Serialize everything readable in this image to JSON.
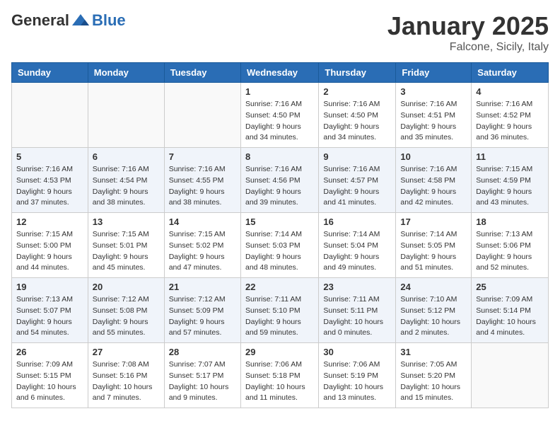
{
  "header": {
    "logo": {
      "general": "General",
      "blue": "Blue"
    },
    "title": "January 2025",
    "location": "Falcone, Sicily, Italy"
  },
  "weekdays": [
    "Sunday",
    "Monday",
    "Tuesday",
    "Wednesday",
    "Thursday",
    "Friday",
    "Saturday"
  ],
  "weeks": [
    [
      {
        "day": "",
        "sunrise": "",
        "sunset": "",
        "daylight": ""
      },
      {
        "day": "",
        "sunrise": "",
        "sunset": "",
        "daylight": ""
      },
      {
        "day": "",
        "sunrise": "",
        "sunset": "",
        "daylight": ""
      },
      {
        "day": "1",
        "sunrise": "Sunrise: 7:16 AM",
        "sunset": "Sunset: 4:50 PM",
        "daylight": "Daylight: 9 hours and 34 minutes."
      },
      {
        "day": "2",
        "sunrise": "Sunrise: 7:16 AM",
        "sunset": "Sunset: 4:50 PM",
        "daylight": "Daylight: 9 hours and 34 minutes."
      },
      {
        "day": "3",
        "sunrise": "Sunrise: 7:16 AM",
        "sunset": "Sunset: 4:51 PM",
        "daylight": "Daylight: 9 hours and 35 minutes."
      },
      {
        "day": "4",
        "sunrise": "Sunrise: 7:16 AM",
        "sunset": "Sunset: 4:52 PM",
        "daylight": "Daylight: 9 hours and 36 minutes."
      }
    ],
    [
      {
        "day": "5",
        "sunrise": "Sunrise: 7:16 AM",
        "sunset": "Sunset: 4:53 PM",
        "daylight": "Daylight: 9 hours and 37 minutes."
      },
      {
        "day": "6",
        "sunrise": "Sunrise: 7:16 AM",
        "sunset": "Sunset: 4:54 PM",
        "daylight": "Daylight: 9 hours and 38 minutes."
      },
      {
        "day": "7",
        "sunrise": "Sunrise: 7:16 AM",
        "sunset": "Sunset: 4:55 PM",
        "daylight": "Daylight: 9 hours and 38 minutes."
      },
      {
        "day": "8",
        "sunrise": "Sunrise: 7:16 AM",
        "sunset": "Sunset: 4:56 PM",
        "daylight": "Daylight: 9 hours and 39 minutes."
      },
      {
        "day": "9",
        "sunrise": "Sunrise: 7:16 AM",
        "sunset": "Sunset: 4:57 PM",
        "daylight": "Daylight: 9 hours and 41 minutes."
      },
      {
        "day": "10",
        "sunrise": "Sunrise: 7:16 AM",
        "sunset": "Sunset: 4:58 PM",
        "daylight": "Daylight: 9 hours and 42 minutes."
      },
      {
        "day": "11",
        "sunrise": "Sunrise: 7:15 AM",
        "sunset": "Sunset: 4:59 PM",
        "daylight": "Daylight: 9 hours and 43 minutes."
      }
    ],
    [
      {
        "day": "12",
        "sunrise": "Sunrise: 7:15 AM",
        "sunset": "Sunset: 5:00 PM",
        "daylight": "Daylight: 9 hours and 44 minutes."
      },
      {
        "day": "13",
        "sunrise": "Sunrise: 7:15 AM",
        "sunset": "Sunset: 5:01 PM",
        "daylight": "Daylight: 9 hours and 45 minutes."
      },
      {
        "day": "14",
        "sunrise": "Sunrise: 7:15 AM",
        "sunset": "Sunset: 5:02 PM",
        "daylight": "Daylight: 9 hours and 47 minutes."
      },
      {
        "day": "15",
        "sunrise": "Sunrise: 7:14 AM",
        "sunset": "Sunset: 5:03 PM",
        "daylight": "Daylight: 9 hours and 48 minutes."
      },
      {
        "day": "16",
        "sunrise": "Sunrise: 7:14 AM",
        "sunset": "Sunset: 5:04 PM",
        "daylight": "Daylight: 9 hours and 49 minutes."
      },
      {
        "day": "17",
        "sunrise": "Sunrise: 7:14 AM",
        "sunset": "Sunset: 5:05 PM",
        "daylight": "Daylight: 9 hours and 51 minutes."
      },
      {
        "day": "18",
        "sunrise": "Sunrise: 7:13 AM",
        "sunset": "Sunset: 5:06 PM",
        "daylight": "Daylight: 9 hours and 52 minutes."
      }
    ],
    [
      {
        "day": "19",
        "sunrise": "Sunrise: 7:13 AM",
        "sunset": "Sunset: 5:07 PM",
        "daylight": "Daylight: 9 hours and 54 minutes."
      },
      {
        "day": "20",
        "sunrise": "Sunrise: 7:12 AM",
        "sunset": "Sunset: 5:08 PM",
        "daylight": "Daylight: 9 hours and 55 minutes."
      },
      {
        "day": "21",
        "sunrise": "Sunrise: 7:12 AM",
        "sunset": "Sunset: 5:09 PM",
        "daylight": "Daylight: 9 hours and 57 minutes."
      },
      {
        "day": "22",
        "sunrise": "Sunrise: 7:11 AM",
        "sunset": "Sunset: 5:10 PM",
        "daylight": "Daylight: 9 hours and 59 minutes."
      },
      {
        "day": "23",
        "sunrise": "Sunrise: 7:11 AM",
        "sunset": "Sunset: 5:11 PM",
        "daylight": "Daylight: 10 hours and 0 minutes."
      },
      {
        "day": "24",
        "sunrise": "Sunrise: 7:10 AM",
        "sunset": "Sunset: 5:12 PM",
        "daylight": "Daylight: 10 hours and 2 minutes."
      },
      {
        "day": "25",
        "sunrise": "Sunrise: 7:09 AM",
        "sunset": "Sunset: 5:14 PM",
        "daylight": "Daylight: 10 hours and 4 minutes."
      }
    ],
    [
      {
        "day": "26",
        "sunrise": "Sunrise: 7:09 AM",
        "sunset": "Sunset: 5:15 PM",
        "daylight": "Daylight: 10 hours and 6 minutes."
      },
      {
        "day": "27",
        "sunrise": "Sunrise: 7:08 AM",
        "sunset": "Sunset: 5:16 PM",
        "daylight": "Daylight: 10 hours and 7 minutes."
      },
      {
        "day": "28",
        "sunrise": "Sunrise: 7:07 AM",
        "sunset": "Sunset: 5:17 PM",
        "daylight": "Daylight: 10 hours and 9 minutes."
      },
      {
        "day": "29",
        "sunrise": "Sunrise: 7:06 AM",
        "sunset": "Sunset: 5:18 PM",
        "daylight": "Daylight: 10 hours and 11 minutes."
      },
      {
        "day": "30",
        "sunrise": "Sunrise: 7:06 AM",
        "sunset": "Sunset: 5:19 PM",
        "daylight": "Daylight: 10 hours and 13 minutes."
      },
      {
        "day": "31",
        "sunrise": "Sunrise: 7:05 AM",
        "sunset": "Sunset: 5:20 PM",
        "daylight": "Daylight: 10 hours and 15 minutes."
      },
      {
        "day": "",
        "sunrise": "",
        "sunset": "",
        "daylight": ""
      }
    ]
  ]
}
